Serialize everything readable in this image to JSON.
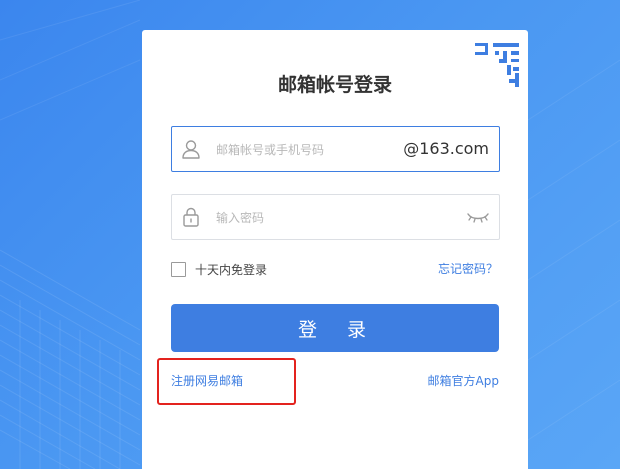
{
  "login": {
    "title": "邮箱帐号登录",
    "account_placeholder": "邮箱帐号或手机号码",
    "account_value": "",
    "domain_suffix": "@163.com",
    "password_placeholder": "输入密码",
    "password_value": "",
    "remember_label": "十天内免登录",
    "remember_checked": false,
    "forgot_label": "忘记密码？",
    "submit_label": "登 录",
    "register_label": "注册网易邮箱",
    "app_label": "邮箱官方App"
  },
  "icons": {
    "qr_corner": "qr-code-icon",
    "account": "user-icon",
    "password": "lock-icon",
    "visibility": "eye-closed-icon"
  },
  "colors": {
    "accent": "#3e7ee1",
    "background": "#4a97f2",
    "highlight": "#e3231e"
  }
}
